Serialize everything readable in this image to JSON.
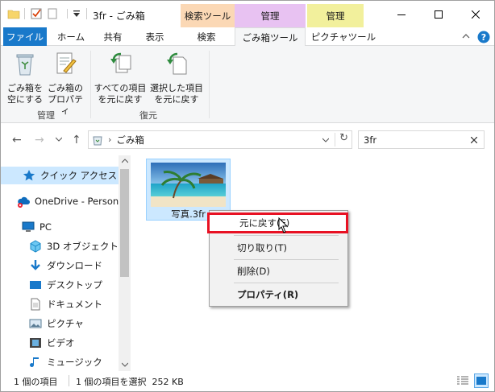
{
  "title": {
    "window_title": "3fr - ごみ箱",
    "contextual_headers": [
      {
        "label": "検索ツール",
        "color": "#fbd8b5"
      },
      {
        "label": "管理",
        "color": "#e8c2f2"
      },
      {
        "label": "管理",
        "color": "#f2f09c"
      }
    ]
  },
  "tabs": {
    "file": "ファイル",
    "home": "ホーム",
    "share": "共有",
    "view": "表示",
    "search": "検索",
    "recycle_tools": "ごみ箱ツール",
    "picture_tools": "ピクチャツール"
  },
  "ribbon": {
    "groups": {
      "manage": "管理",
      "restore": "復元"
    },
    "buttons": {
      "empty_bin_l1": "ごみ箱を",
      "empty_bin_l2": "空にする",
      "bin_props_l1": "ごみ箱の",
      "bin_props_l2": "プロパティ",
      "restore_all_l1": "すべての項目",
      "restore_all_l2": "を元に戻す",
      "restore_sel_l1": "選択した項目",
      "restore_sel_l2": "を元に戻す"
    }
  },
  "address": {
    "path": "ごみ箱",
    "search_value": "3fr"
  },
  "nav": {
    "quick_access": "クイック アクセス",
    "onedrive": "OneDrive - Personal",
    "pc": "PC",
    "objects3d": "3D オブジェクト",
    "downloads": "ダウンロード",
    "desktop": "デスクトップ",
    "documents": "ドキュメント",
    "pictures": "ピクチャ",
    "videos": "ビデオ",
    "music": "ミュージック"
  },
  "file": {
    "name": "写真.3fr"
  },
  "context_menu": {
    "restore": "元に戻す(E)",
    "cut": "切り取り(T)",
    "delete": "削除(D)",
    "properties": "プロパティ(R)"
  },
  "status": {
    "item_count": "1 個の項目",
    "selection": "1 個の項目を選択  252 KB"
  },
  "colors": {
    "file_tab": "#1979ca",
    "selection": "#cce8ff",
    "highlight_border": "#e81123"
  }
}
